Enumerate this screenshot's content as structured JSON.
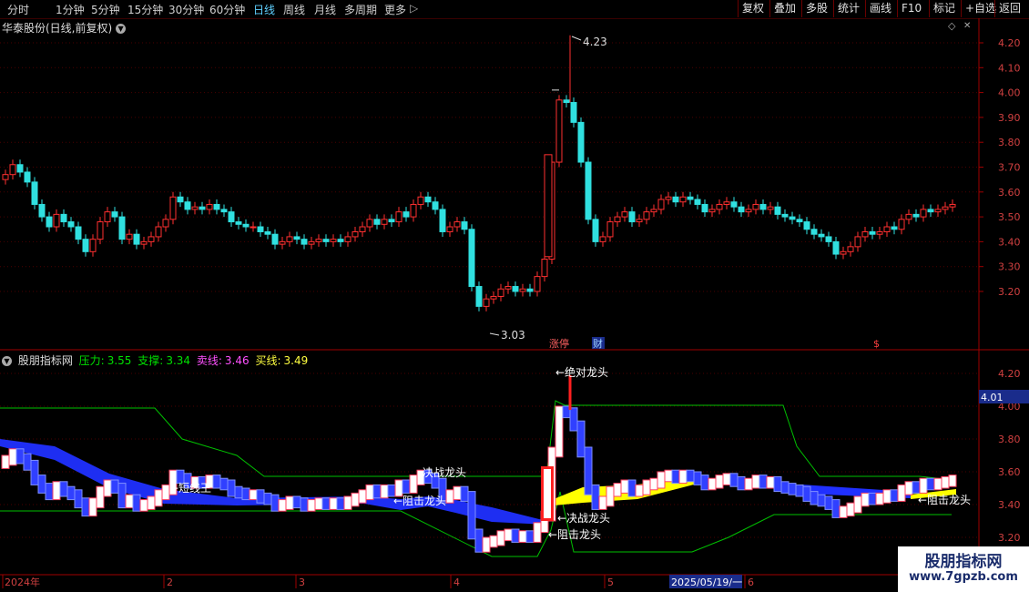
{
  "toolbar": {
    "periods": [
      "分时",
      "1分钟",
      "5分钟",
      "15分钟",
      "30分钟",
      "60分钟",
      "日线",
      "周线",
      "月线",
      "多周期",
      "更多"
    ],
    "active_period": "日线",
    "right_buttons": [
      "复权",
      "叠加",
      "多股",
      "统计",
      "画线",
      "F10",
      "标记",
      "+自选",
      "返回"
    ]
  },
  "stock_title": "华泰股份(日线,前复权)",
  "main_chart": {
    "y_ticks": [
      "4.20",
      "4.10",
      "4.00",
      "3.90",
      "3.80",
      "3.70",
      "3.60",
      "3.50",
      "3.40",
      "3.30",
      "3.20"
    ],
    "high_label": "4.23",
    "low_label": "3.03",
    "markers": [
      "涨停",
      "财",
      "$"
    ]
  },
  "indicator": {
    "name": "股朋指标网",
    "values": [
      {
        "label": "压力:",
        "value": "3.55",
        "color": "#00e000"
      },
      {
        "label": "支撑:",
        "value": "3.34",
        "color": "#00e000"
      },
      {
        "label": "卖线:",
        "value": "3.46",
        "color": "#ff50ff"
      },
      {
        "label": "买线:",
        "value": "3.49",
        "color": "#ffff40"
      }
    ],
    "y_ticks": [
      "4.20",
      "4.00",
      "3.80",
      "3.60",
      "3.40",
      "3.20"
    ],
    "current_value": "4.01",
    "annotations": [
      "决战龙头",
      "←绝对龙头",
      "←短线王",
      "←阻击龙头",
      "←决战龙头",
      "←阻击龙头",
      "←阻击龙头"
    ]
  },
  "x_axis": {
    "labels": [
      "2024年",
      "2",
      "3",
      "4",
      "5",
      "2025/05/19/一",
      "6"
    ]
  },
  "watermark": {
    "line1": "股朋指标网",
    "line2": "www.7gpzb.com"
  }
}
